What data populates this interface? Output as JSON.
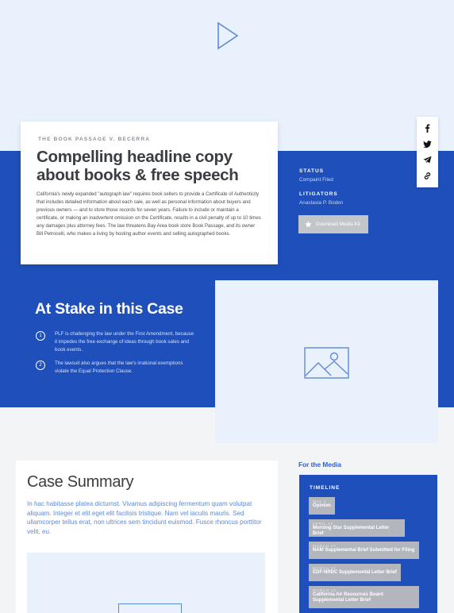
{
  "video": {
    "icon": "play-icon"
  },
  "case_card": {
    "eyebrow": "THE BOOK PASSAGE V. BECERRA",
    "headline": "Compelling headline copy about books & free speech",
    "body": "California's newly expanded \"autograph law\" requires book sellers to provide a Certificate of Authenticity that includes detailed information about each sale, as well as personal information about buyers and previous owners — and to store those records for seven years.  Failure to include or maintain a certificate, or making an inadvertent omission on the Certificate, results in a civil penalty of up to 10 times any damages plus attorney fees. The law threatens Bay Area book store Book Passage, and its owner Bill Petrocelli, who makes a living by hosting author events and selling autographed books."
  },
  "share": [
    "facebook-icon",
    "twitter-icon",
    "telegram-icon",
    "link-icon"
  ],
  "meta": {
    "status_label": "STATUS",
    "status_value": "Compaint Filed",
    "litigators_label": "LITIGATORS",
    "litigators_value": "Anastasia P. Boden",
    "download_label": "Download Media Kit"
  },
  "stake": {
    "title": "At Stake in this Case",
    "items": [
      {
        "num": "1",
        "text": "PLF is challenging the law under the First Amendment, because it impedes the free exchange of ideas through book sales and book events."
      },
      {
        "num": "2",
        "text": "The lawsuit also argues that the law's irrational exemptions violate the Equal Protection Clause."
      }
    ]
  },
  "summary": {
    "title": "Case Summary",
    "text": "In hac habitasse platea dictumst. Vivamus adipiscing fermentum quam volutpat aliquam. Integer et elit eget elit facilisis tristique. Nam vel iaculis mauris. Sed ullamcorper tellus erat, non ultrices sem tincidunt euismod. Fusce rhoncus porttitor velit, eu."
  },
  "media": {
    "label": "For the Media",
    "timeline_title": "TIMELINE",
    "items": [
      {
        "date": "MAY 2",
        "text": "Opinion"
      },
      {
        "date": "APRIL 14",
        "text": "Morning Star Supplemental Letter Brief"
      },
      {
        "date": "MARCH 27",
        "text": "NAM Supplemental Brief Submitted for Filing"
      },
      {
        "date": "MARCH 21",
        "text": "EDF-NRDC Supplemental Letter Brief"
      },
      {
        "date": "MARCH 13",
        "text": "California Air Resources Board Supplemental Letter Brief"
      }
    ]
  },
  "colors": {
    "brand_blue": "#1f4fba",
    "light_blue": "#e9f1fc",
    "link_blue": "#5e89d8"
  }
}
